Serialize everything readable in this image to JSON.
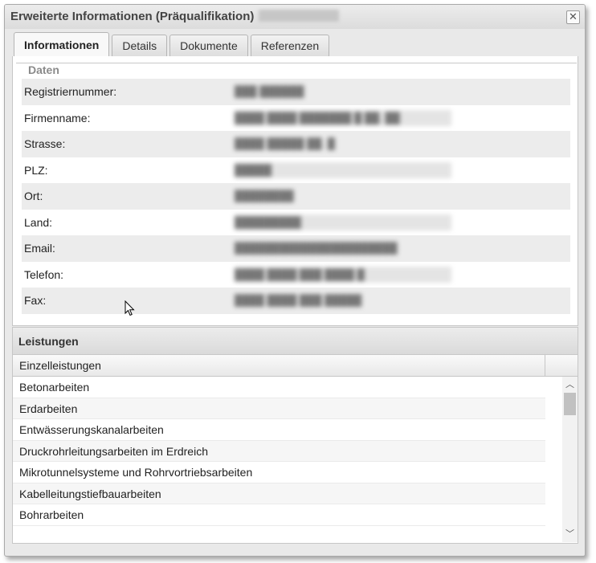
{
  "window": {
    "title": "Erweiterte Informationen (Präqualifikation)",
    "title_suffix_redacted": "███████",
    "close_glyph": "✕"
  },
  "tabs": [
    {
      "label": "Informationen",
      "active": true
    },
    {
      "label": "Details",
      "active": false
    },
    {
      "label": "Dokumente",
      "active": false
    },
    {
      "label": "Referenzen",
      "active": false
    }
  ],
  "daten": {
    "legend": "Daten",
    "rows": [
      {
        "label": "Registriernummer:",
        "value": "███ ██████"
      },
      {
        "label": "Firmenname:",
        "value": "████ ████ ███████ █ ██. ██"
      },
      {
        "label": "Strasse:",
        "value": "████ █████ ██. █"
      },
      {
        "label": "PLZ:",
        "value": "█████"
      },
      {
        "label": "Ort:",
        "value": "████████"
      },
      {
        "label": "Land:",
        "value": "█████████"
      },
      {
        "label": "Email:",
        "value": "██████████████████████"
      },
      {
        "label": "Telefon:",
        "value": "████ ████ ███ ████ █"
      },
      {
        "label": "Fax:",
        "value": "████ ████ ███ █████"
      }
    ]
  },
  "leistungen": {
    "title": "Leistungen",
    "column_header": "Einzelleistungen",
    "items": [
      "Betonarbeiten",
      "Erdarbeiten",
      "Entwässerungskanalarbeiten",
      "Druckrohrleitungsarbeiten im Erdreich",
      "Mikrotunnelsysteme und Rohrvortriebsarbeiten",
      "Kabelleitungstiefbauarbeiten",
      "Bohrarbeiten"
    ]
  },
  "scrollbar": {
    "up_glyph": "︿",
    "down_glyph": "﹀"
  }
}
